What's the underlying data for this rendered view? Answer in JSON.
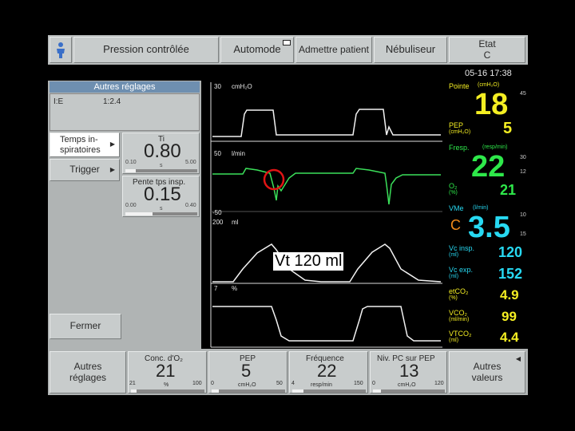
{
  "topbar": {
    "mode": "Pression contrôlée",
    "automode": "Automode",
    "admettre": "Admettre patient",
    "nebuliseur": "Nébuliseur",
    "etat_title": "Etat",
    "etat_value": "C",
    "datetime": "05-16 17:38"
  },
  "panel": {
    "title": "Autres réglages",
    "ie_label": "I:E",
    "ie_value": "1:2.4",
    "temps_label": "Temps in- spiratoires",
    "trigger_label": "Trigger",
    "fermer_label": "Fermer",
    "ti": {
      "label": "Ti",
      "value": "0.80",
      "min": "0.10",
      "max": "5.00",
      "unit": "s",
      "level": 0.14
    },
    "pente": {
      "label": "Pente tps insp.",
      "value": "0.15",
      "min": "0.00",
      "max": "0.40",
      "unit": "s",
      "level": 0.38
    }
  },
  "waveforms": {
    "pressure": {
      "max": "30",
      "unit": "cmH₂O"
    },
    "flow": {
      "max": "50",
      "unit": "l/min",
      "min": "-50"
    },
    "volume": {
      "max": "200",
      "unit": "ml"
    },
    "co2": {
      "max": "7",
      "unit": "%"
    },
    "annotation": "Vt 120 ml"
  },
  "values": {
    "pointe": {
      "label": "Pointe",
      "unit": "(cmH₂O)",
      "value": "18",
      "hi": "45"
    },
    "pep": {
      "label": "PEP",
      "unit": "(cmH₂O)",
      "value": "5"
    },
    "freq": {
      "label": "Fresp.",
      "unit": "(resp/min)",
      "value": "22",
      "hi": "30",
      "lo": "12"
    },
    "o2": {
      "label": "O₂",
      "unit": "(%)",
      "value": "21"
    },
    "vme": {
      "label": "VMe",
      "unit": "(l/min)",
      "value": "3.5",
      "hi": "10",
      "lo": "15",
      "prefix": "C"
    },
    "vc_insp": {
      "label": "Vc insp.",
      "unit": "(ml)",
      "value": "120"
    },
    "vc_exp": {
      "label": "Vc exp.",
      "unit": "(ml)",
      "value": "152"
    },
    "etco2": {
      "label": "etCO₂",
      "unit": "(%)",
      "value": "4.9"
    },
    "vco2": {
      "label": "VCO₂",
      "unit": "(ml/min)",
      "value": "99"
    },
    "vtco2": {
      "label": "VTCO₂",
      "unit": "(ml)",
      "value": "4.4"
    }
  },
  "bottombar": {
    "autres_reglages": "Autres réglages",
    "autres_valeurs": "Autres valeurs",
    "params": [
      {
        "label": "Conc. d'O₂",
        "value": "21",
        "min": "21",
        "max": "100",
        "unit": "%",
        "level": 0.0
      },
      {
        "label": "PEP",
        "value": "5",
        "min": "0",
        "max": "50",
        "unit": "cmH₂O",
        "level": 0.1
      },
      {
        "label": "Fréquence",
        "value": "22",
        "min": "4",
        "max": "150",
        "unit": "resp/min",
        "level": 0.15
      },
      {
        "label": "Niv. PC sur PEP",
        "value": "13",
        "min": "0",
        "max": "120",
        "unit": "cmH₂O",
        "level": 0.11
      }
    ]
  },
  "colors": {
    "yellow": "#f4ee22",
    "green": "#2ee84a",
    "cyan": "#27d9f2",
    "highlight": "#e01414"
  }
}
